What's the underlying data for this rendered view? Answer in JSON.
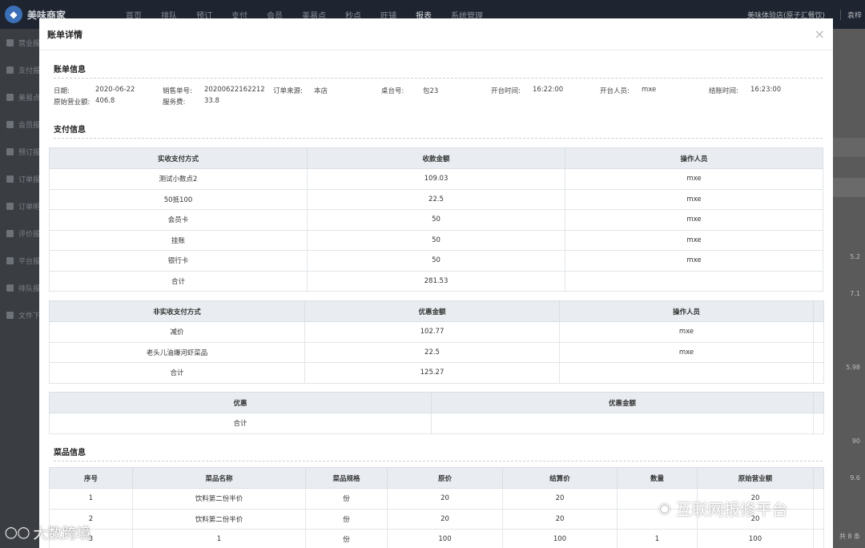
{
  "app": {
    "brand": "美味商家",
    "nav": [
      "首页",
      "排队",
      "预订",
      "支付",
      "会员",
      "美易点",
      "秒点",
      "旺铺",
      "报表",
      "系统管理"
    ],
    "store": "美味体验店(原子汇餐饮)",
    "user": "袁梓"
  },
  "sidebar": [
    "营业报表",
    "支付报表",
    "美易点报表",
    "会员报表",
    "预订报表",
    "订单报表",
    "订单明细",
    "评价报表",
    "平台报表",
    "排队报表",
    "文件下载"
  ],
  "background": {
    "nums": [
      "5.2",
      "7.1",
      "5.98",
      "90",
      "9.6",
      "共 8 条"
    ]
  },
  "modal": {
    "title": "账单详情",
    "close": "×",
    "bill_info": {
      "title": "账单信息",
      "row1": [
        {
          "label": "日期:",
          "value": "2020-06-22"
        },
        {
          "label": "销售单号:",
          "value": "20200622162212"
        },
        {
          "label": "订单来源:",
          "value": "本店"
        },
        {
          "label": "桌台号:",
          "value": "包23"
        },
        {
          "label": "开台时间:",
          "value": "16:22:00"
        },
        {
          "label": "开台人员:",
          "value": "mxe"
        },
        {
          "label": "结账时间:",
          "value": "16:23:00"
        }
      ],
      "row2": [
        {
          "label": "原始营业额:",
          "value": "406.8"
        },
        {
          "label": "服务费:",
          "value": "33.8"
        }
      ]
    },
    "payment_info": {
      "title": "支付信息",
      "actual": {
        "headers": [
          "实收支付方式",
          "收款金额",
          "操作人员"
        ],
        "rows": [
          [
            "测试小数点2",
            "109.03",
            "mxe"
          ],
          [
            "50抵100",
            "22.5",
            "mxe"
          ],
          [
            "会员卡",
            "50",
            "mxe"
          ],
          [
            "挂账",
            "50",
            "mxe"
          ],
          [
            "银行卡",
            "50",
            "mxe"
          ],
          [
            "合计",
            "281.53",
            ""
          ]
        ]
      },
      "non_actual": {
        "headers": [
          "非实收支付方式",
          "优惠金额",
          "操作人员"
        ],
        "rows": [
          [
            "减价",
            "102.77",
            "mxe"
          ],
          [
            "老头儿油爆河虾菜品",
            "22.5",
            "mxe"
          ],
          [
            "合计",
            "125.27",
            ""
          ]
        ]
      },
      "discount": {
        "headers": [
          "优惠",
          "优惠金额"
        ],
        "rows": [
          [
            "合计",
            ""
          ]
        ]
      }
    },
    "dish_info": {
      "title": "菜品信息",
      "headers": [
        "序号",
        "菜品名称",
        "菜品规格",
        "原价",
        "结算价",
        "数量",
        "原始营业额"
      ],
      "rows": [
        [
          "1",
          "饮料第二份半价",
          "份",
          "20",
          "20",
          "",
          "20"
        ],
        [
          "2",
          "饮料第二份半价",
          "份",
          "20",
          "20",
          "",
          "20"
        ],
        [
          "3",
          "1",
          "份",
          "100",
          "100",
          "1",
          "100"
        ]
      ]
    }
  },
  "watermarks": {
    "right": "互联网报修平台",
    "left": "大数跨境"
  }
}
